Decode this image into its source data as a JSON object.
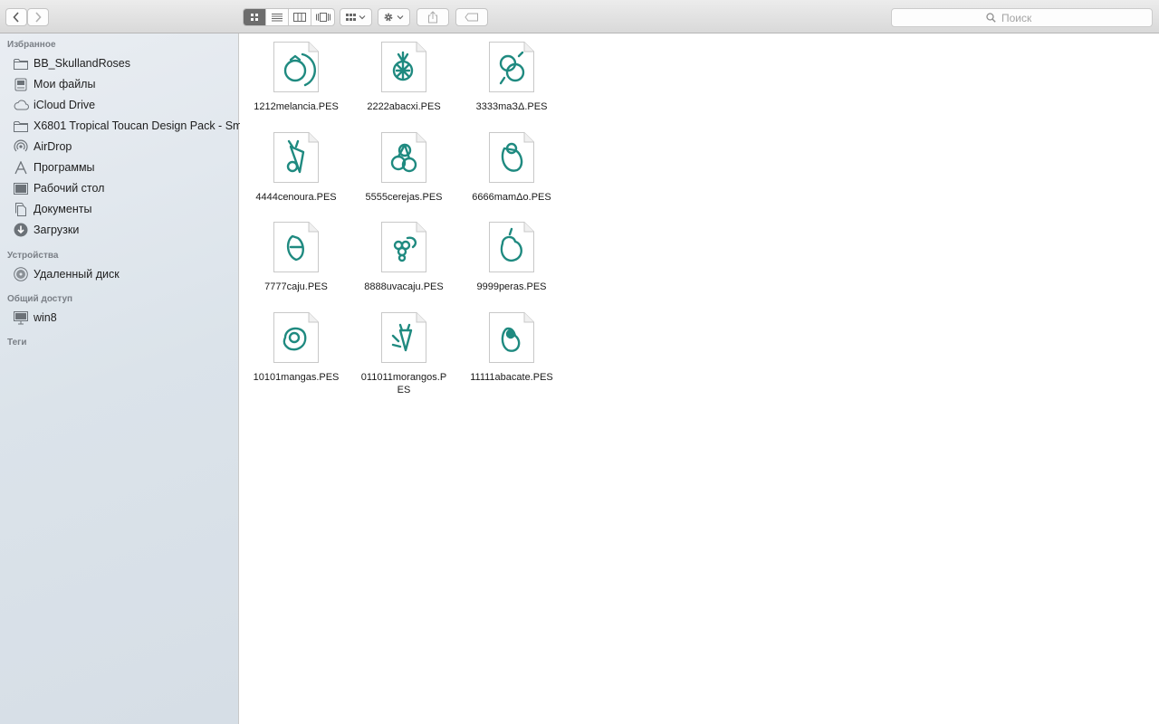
{
  "toolbar": {
    "back_icon": "chevron-left-icon",
    "forward_icon": "chevron-right-icon",
    "view_modes": [
      "icon-view-icon",
      "list-view-icon",
      "column-view-icon",
      "cover-flow-icon"
    ],
    "active_view": "icon-view-icon",
    "search_placeholder": "Поиск"
  },
  "sidebar": {
    "sections": [
      {
        "title": "Избранное",
        "items": [
          {
            "label": "BB_SkullandRoses",
            "icon": "folder-icon"
          },
          {
            "label": "Мои файлы",
            "icon": "all-files-icon"
          },
          {
            "label": "iCloud Drive",
            "icon": "cloud-icon"
          },
          {
            "label": "X6801 Tropical Toucan Design Pack - Sm",
            "icon": "folder-icon"
          },
          {
            "label": "AirDrop",
            "icon": "airdrop-icon"
          },
          {
            "label": "Программы",
            "icon": "applications-icon"
          },
          {
            "label": "Рабочий стол",
            "icon": "desktop-icon"
          },
          {
            "label": "Документы",
            "icon": "documents-icon"
          },
          {
            "label": "Загрузки",
            "icon": "downloads-icon"
          }
        ]
      },
      {
        "title": "Устройства",
        "items": [
          {
            "label": "Удаленный диск",
            "icon": "remote-disc-icon"
          }
        ]
      },
      {
        "title": "Общий доступ",
        "items": [
          {
            "label": "win8",
            "icon": "computer-icon"
          }
        ]
      },
      {
        "title": "Теги",
        "items": []
      }
    ]
  },
  "files": [
    {
      "name": "1212melancia.PES"
    },
    {
      "name": "2222abacxi.PES"
    },
    {
      "name": "3333maЗΔ.PES"
    },
    {
      "name": "4444cenoura.PES"
    },
    {
      "name": "5555cerejas.PES"
    },
    {
      "name": "6666mamΔo.PES"
    },
    {
      "name": "7777caju.PES"
    },
    {
      "name": "8888uvacaju.PES"
    },
    {
      "name": "9999peras.PES"
    },
    {
      "name": "10101mangas.PES"
    },
    {
      "name": "011011morangos.PES"
    },
    {
      "name": "11111abacate.PES"
    }
  ],
  "colors": {
    "embroidery": "#1f8a80",
    "sidebar_bg": "#dbe3ea",
    "active_view_bg": "#6d6d6d"
  }
}
